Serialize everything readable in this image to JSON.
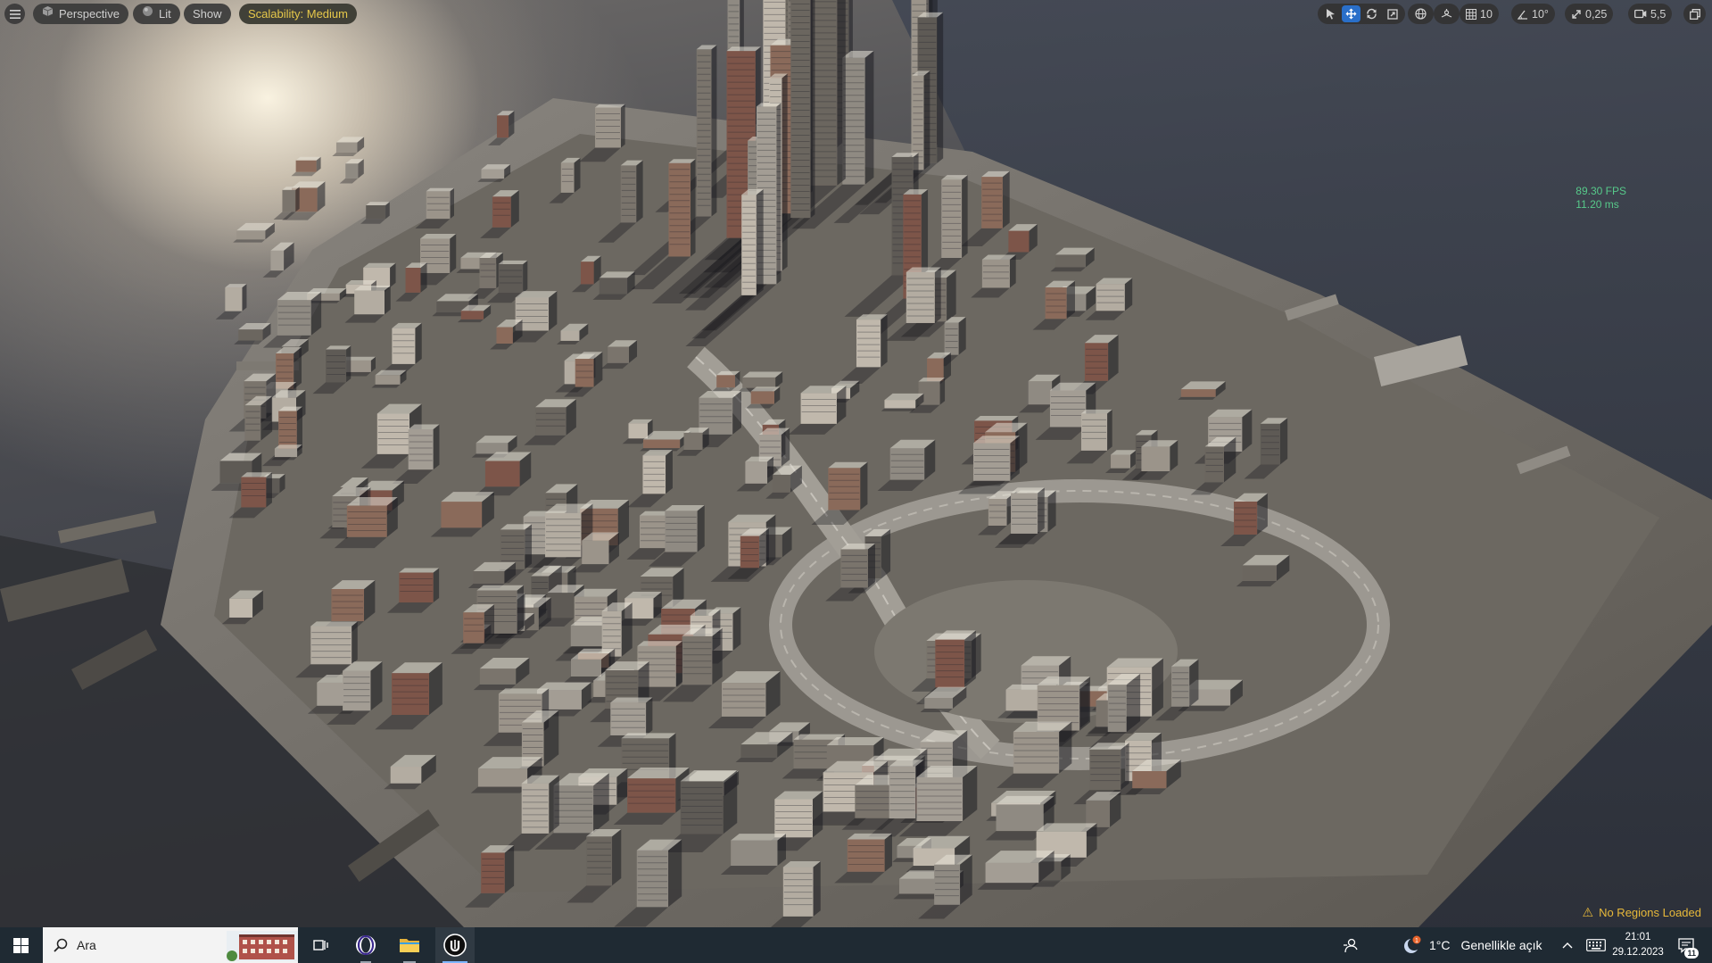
{
  "viewport": {
    "toolbar_left": {
      "perspective_label": "Perspective",
      "lit_label": "Lit",
      "show_label": "Show",
      "scalability_label": "Scalability: Medium",
      "scalability_color": "#e6c84a"
    },
    "toolbar_right": {
      "grid_snap_value": "10",
      "rotation_snap_value": "10°",
      "scale_snap_value": "0,25",
      "camera_speed_value": "5,5",
      "active_tool": "translate",
      "accent_color": "#2a6fc9"
    },
    "stats": {
      "fps": "89.30 FPS",
      "ms": "11.20 ms",
      "color": "#57c98a"
    },
    "status": {
      "message": "No Regions Loaded",
      "color": "#e8b93a"
    }
  },
  "taskbar": {
    "search_placeholder": "Ara",
    "weather": {
      "temperature": "1°C",
      "description": "Genellikle açık"
    },
    "clock": {
      "time": "21:01",
      "date": "29.12.2023"
    },
    "notifications_count": "11",
    "apps": [
      "opera-icon",
      "file-explorer-icon",
      "unreal-engine-icon"
    ]
  }
}
